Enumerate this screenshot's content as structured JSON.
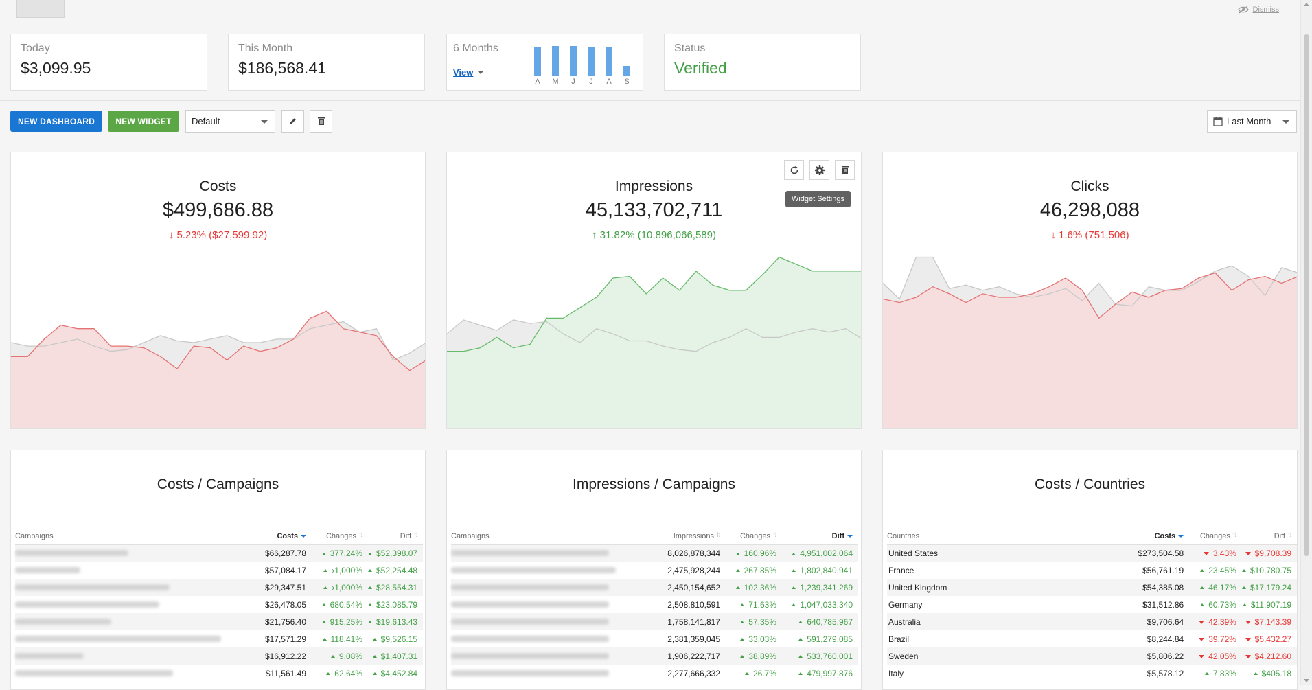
{
  "topbar": {
    "dismiss_label": "Dismiss"
  },
  "stats": [
    {
      "label": "Today",
      "value": "$3,099.95"
    },
    {
      "label": "This Month",
      "value": "$186,568.41"
    },
    {
      "label": "6 Months",
      "view_label": "View",
      "months": [
        "A",
        "M",
        "J",
        "J",
        "A",
        "S"
      ],
      "levels": [
        0.85,
        0.9,
        0.9,
        0.85,
        0.85,
        0.3
      ]
    },
    {
      "label": "Status",
      "value": "Verified"
    }
  ],
  "toolbar": {
    "new_dashboard_label": "NEW DASHBOARD",
    "new_widget_label": "NEW WIDGET",
    "dashboard_select": "Default",
    "date_range": "Last Month"
  },
  "widgets": [
    {
      "title": "Costs",
      "value": "$499,686.88",
      "change": "5.23% ($27,599.92)",
      "direction": "down",
      "color": "#e57373",
      "fill": "#f7dede",
      "current": [
        0.58,
        0.58,
        0.48,
        0.4,
        0.42,
        0.42,
        0.52,
        0.52,
        0.53,
        0.58,
        0.65,
        0.52,
        0.53,
        0.6,
        0.52,
        0.55,
        0.53,
        0.48,
        0.36,
        0.32,
        0.42,
        0.44,
        0.46,
        0.58,
        0.66,
        0.6
      ],
      "previous": [
        0.5,
        0.52,
        0.52,
        0.5,
        0.48,
        0.52,
        0.55,
        0.54,
        0.5,
        0.46,
        0.49,
        0.5,
        0.48,
        0.46,
        0.5,
        0.5,
        0.48,
        0.48,
        0.42,
        0.4,
        0.38,
        0.44,
        0.42,
        0.6,
        0.56,
        0.5
      ]
    },
    {
      "title": "Impressions",
      "value": "45,133,702,711",
      "change": "31.82% (10,896,066,589)",
      "direction": "up",
      "color": "#66bb6a",
      "fill": "#e4f3e5",
      "tools_tooltip": "Widget Settings",
      "current": [
        0.55,
        0.55,
        0.53,
        0.47,
        0.53,
        0.51,
        0.36,
        0.36,
        0.3,
        0.24,
        0.13,
        0.12,
        0.22,
        0.13,
        0.2,
        0.09,
        0.17,
        0.2,
        0.2,
        0.11,
        0.01,
        0.05,
        0.09,
        0.09,
        0.09,
        0.09
      ],
      "previous": [
        0.45,
        0.37,
        0.4,
        0.43,
        0.37,
        0.39,
        0.38,
        0.45,
        0.5,
        0.42,
        0.45,
        0.49,
        0.49,
        0.52,
        0.54,
        0.55,
        0.5,
        0.47,
        0.42,
        0.47,
        0.47,
        0.44,
        0.42,
        0.44,
        0.42,
        0.48
      ]
    },
    {
      "title": "Clicks",
      "value": "46,298,088",
      "change": "1.6% (751,506)",
      "direction": "down",
      "color": "#e57373",
      "fill": "#f7dede",
      "current": [
        0.25,
        0.27,
        0.24,
        0.18,
        0.22,
        0.27,
        0.22,
        0.24,
        0.24,
        0.22,
        0.18,
        0.13,
        0.2,
        0.36,
        0.28,
        0.21,
        0.24,
        0.2,
        0.19,
        0.13,
        0.1,
        0.2,
        0.14,
        0.12,
        0.16,
        0.12
      ],
      "previous": [
        0.16,
        0.25,
        0.01,
        0.01,
        0.19,
        0.17,
        0.2,
        0.18,
        0.22,
        0.24,
        0.22,
        0.19,
        0.26,
        0.16,
        0.28,
        0.29,
        0.18,
        0.2,
        0.2,
        0.15,
        0.09,
        0.06,
        0.12,
        0.23,
        0.07,
        0.1
      ]
    }
  ],
  "tables": [
    {
      "title": "Costs / Campaigns",
      "headers": [
        "Campaigns",
        "Costs",
        "Changes",
        "Diff"
      ],
      "rows": [
        {
          "value": "$66,287.78",
          "change": "377.24%",
          "diff": "$52,398.07",
          "dir": "up",
          "blur": 165
        },
        {
          "value": "$57,084.17",
          "change": "›1,000%",
          "diff": "$52,254.48",
          "dir": "up",
          "blur": 95
        },
        {
          "value": "$29,347.51",
          "change": "›1,000%",
          "diff": "$28,554.31",
          "dir": "up",
          "blur": 225
        },
        {
          "value": "$26,478.05",
          "change": "680.54%",
          "diff": "$23,085.79",
          "dir": "up",
          "blur": 210
        },
        {
          "value": "$21,756.40",
          "change": "915.25%",
          "diff": "$19,613.43",
          "dir": "up",
          "blur": 140
        },
        {
          "value": "$17,571.29",
          "change": "118.41%",
          "diff": "$9,526.15",
          "dir": "up",
          "blur": 300
        },
        {
          "value": "$16,912.22",
          "change": "9.08%",
          "diff": "$1,407.31",
          "dir": "up",
          "blur": 100
        },
        {
          "value": "$11,561.49",
          "change": "62.64%",
          "diff": "$4,452.84",
          "dir": "up",
          "blur": 230
        }
      ]
    },
    {
      "title": "Impressions / Campaigns",
      "headers": [
        "Campaigns",
        "Impressions",
        "Changes",
        "Diff"
      ],
      "rows": [
        {
          "value": "8,026,878,344",
          "change": "160.96%",
          "diff": "4,951,002,064",
          "dir": "up",
          "blur": 230
        },
        {
          "value": "2,475,928,244",
          "change": "267.85%",
          "diff": "1,802,840,941",
          "dir": "up",
          "blur": 240
        },
        {
          "value": "2,450,154,652",
          "change": "102.36%",
          "diff": "1,239,341,269",
          "dir": "up",
          "blur": 230
        },
        {
          "value": "2,508,810,591",
          "change": "71.63%",
          "diff": "1,047,033,340",
          "dir": "up",
          "blur": 230
        },
        {
          "value": "1,758,141,817",
          "change": "57.35%",
          "diff": "640,785,967",
          "dir": "up",
          "blur": 230
        },
        {
          "value": "2,381,359,045",
          "change": "33.03%",
          "diff": "591,279,085",
          "dir": "up",
          "blur": 230
        },
        {
          "value": "1,906,222,717",
          "change": "38.89%",
          "diff": "533,760,001",
          "dir": "up",
          "blur": 230
        },
        {
          "value": "2,277,666,332",
          "change": "26.7%",
          "diff": "479,997,876",
          "dir": "up",
          "blur": 230
        }
      ]
    },
    {
      "title": "Costs / Countries",
      "headers": [
        "Countries",
        "Costs",
        "Changes",
        "Diff"
      ],
      "rows": [
        {
          "name": "United States",
          "value": "$273,504.58",
          "change": "3.43%",
          "diff": "$9,708.39",
          "dir": "down"
        },
        {
          "name": "France",
          "value": "$56,761.19",
          "change": "23.45%",
          "diff": "$10,780.75",
          "dir": "up"
        },
        {
          "name": "United Kingdom",
          "value": "$54,385.08",
          "change": "46.17%",
          "diff": "$17,179.24",
          "dir": "up"
        },
        {
          "name": "Germany",
          "value": "$31,512.86",
          "change": "60.73%",
          "diff": "$11,907.19",
          "dir": "up"
        },
        {
          "name": "Australia",
          "value": "$9,706.64",
          "change": "42.39%",
          "diff": "$7,143.39",
          "dir": "down"
        },
        {
          "name": "Brazil",
          "value": "$8,244.84",
          "change": "39.72%",
          "diff": "$5,432.27",
          "dir": "down"
        },
        {
          "name": "Sweden",
          "value": "$5,806.22",
          "change": "42.05%",
          "diff": "$4,212.60",
          "dir": "down"
        },
        {
          "name": "Italy",
          "value": "$5,578.12",
          "change": "7.83%",
          "diff": "$405.18",
          "dir": "up"
        }
      ]
    }
  ]
}
